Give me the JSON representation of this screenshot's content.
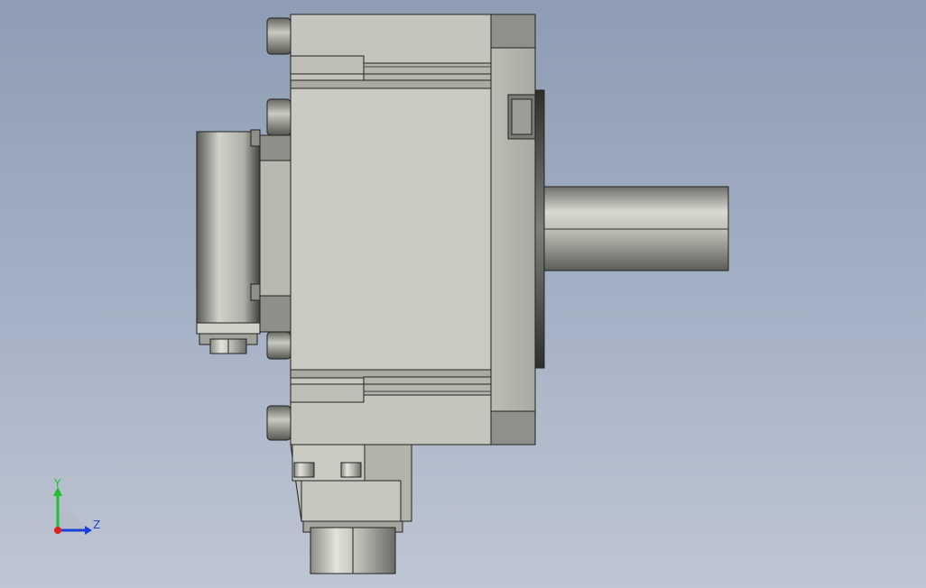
{
  "colors": {
    "background_top": "#8e9db4",
    "background_bottom": "#bfc6d3",
    "body": "#c4c5bd",
    "edge": "#222222",
    "axis_x": "#e0201a",
    "axis_y": "#22c02a",
    "axis_z": "#1d40d8"
  },
  "triad": {
    "y_label": "Y",
    "z_label": "Z"
  }
}
